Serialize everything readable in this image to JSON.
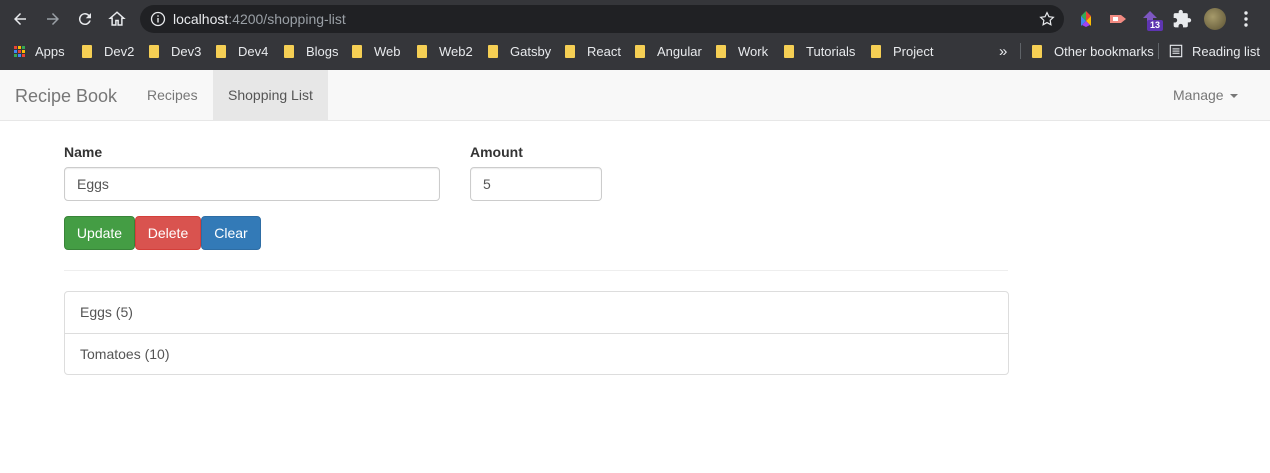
{
  "browser": {
    "url_host": "localhost",
    "url_path": ":4200/shopping-list",
    "extension_badge": "13",
    "bookmarks": [
      {
        "label": "Apps"
      },
      {
        "label": "Dev2"
      },
      {
        "label": "Dev3"
      },
      {
        "label": "Dev4"
      },
      {
        "label": "Blogs"
      },
      {
        "label": "Web"
      },
      {
        "label": "Web2"
      },
      {
        "label": "Gatsby"
      },
      {
        "label": "React"
      },
      {
        "label": "Angular"
      },
      {
        "label": "Work"
      },
      {
        "label": "Tutorials"
      },
      {
        "label": "Project"
      }
    ],
    "overflow": "»",
    "other_bookmarks": "Other bookmarks",
    "reading_list": "Reading list"
  },
  "navbar": {
    "brand": "Recipe Book",
    "links": [
      {
        "label": "Recipes",
        "active": false
      },
      {
        "label": "Shopping List",
        "active": true
      }
    ],
    "manage": "Manage"
  },
  "form": {
    "name_label": "Name",
    "name_value": "Eggs",
    "amount_label": "Amount",
    "amount_value": "5",
    "buttons": {
      "update": "Update",
      "delete": "Delete",
      "clear": "Clear"
    }
  },
  "shopping_list": [
    {
      "text": "Eggs (5)"
    },
    {
      "text": "Tomatoes (10)"
    }
  ],
  "colors": {
    "success": "#449d44",
    "danger": "#d9534f",
    "primary": "#337ab7",
    "folder": "#f5cf54"
  }
}
